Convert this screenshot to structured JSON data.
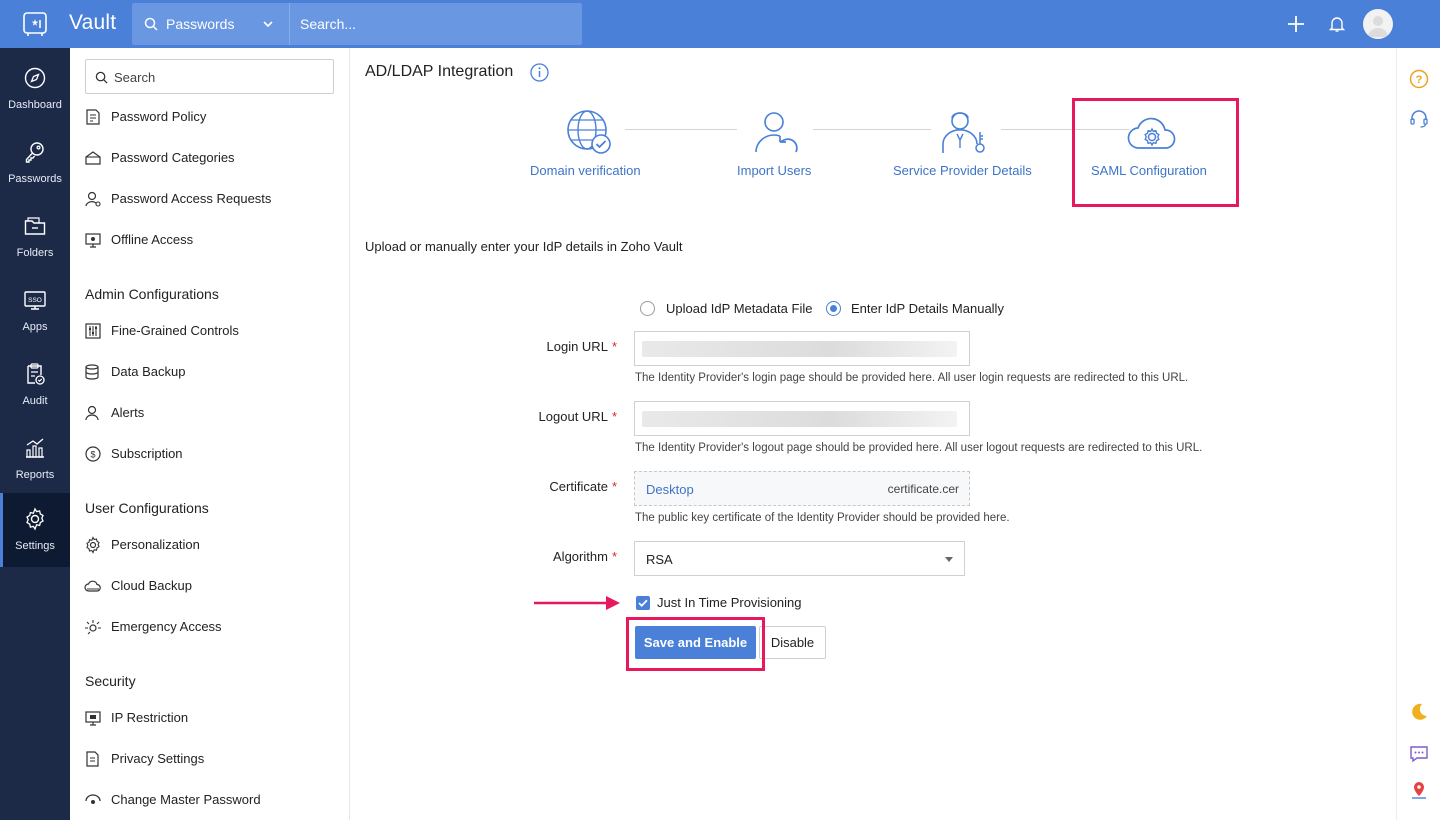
{
  "app": {
    "name": "Vault"
  },
  "topbar": {
    "search_scope": "Passwords",
    "search_placeholder": "Search...",
    "accent": "#4a80d8"
  },
  "rail": {
    "items": [
      {
        "label": "Dashboard",
        "icon": "compass-icon"
      },
      {
        "label": "Passwords",
        "icon": "key-icon"
      },
      {
        "label": "Folders",
        "icon": "folder-icon"
      },
      {
        "label": "Apps",
        "icon": "sso-icon"
      },
      {
        "label": "Audit",
        "icon": "clipboard-icon"
      },
      {
        "label": "Reports",
        "icon": "chart-icon"
      },
      {
        "label": "Settings",
        "icon": "gear-icon",
        "active": true
      }
    ]
  },
  "sidebar": {
    "search_placeholder": "Search",
    "items_top": [
      {
        "label": "Password Policy",
        "icon": "policy-icon"
      },
      {
        "label": "Password Categories",
        "icon": "categories-icon"
      },
      {
        "label": "Password Access Requests",
        "icon": "access-request-icon"
      },
      {
        "label": "Offline Access",
        "icon": "offline-icon"
      }
    ],
    "admin_heading": "Admin Configurations",
    "admin_items": [
      {
        "label": "Fine-Grained Controls",
        "icon": "sliders-icon"
      },
      {
        "label": "Data Backup",
        "icon": "database-icon"
      },
      {
        "label": "Alerts",
        "icon": "alert-user-icon"
      },
      {
        "label": "Subscription",
        "icon": "dollar-icon"
      }
    ],
    "user_heading": "User Configurations",
    "user_items": [
      {
        "label": "Personalization",
        "icon": "gear-icon"
      },
      {
        "label": "Cloud Backup",
        "icon": "cloud-icon"
      },
      {
        "label": "Emergency Access",
        "icon": "emergency-icon"
      }
    ],
    "security_heading": "Security",
    "security_items": [
      {
        "label": "IP Restriction",
        "icon": "monitor-icon"
      },
      {
        "label": "Privacy Settings",
        "icon": "document-icon"
      },
      {
        "label": "Change Master Password",
        "icon": "key-change-icon"
      }
    ]
  },
  "main": {
    "title": "AD/LDAP Integration",
    "steps": [
      {
        "label": "Domain verification",
        "icon": "globe-check-icon"
      },
      {
        "label": "Import Users",
        "icon": "user-import-icon"
      },
      {
        "label": "Service Provider Details",
        "icon": "provider-icon"
      },
      {
        "label": "SAML Configuration",
        "icon": "cloud-gear-icon",
        "highlighted": true
      }
    ],
    "intro": "Upload or manually enter your IdP details in Zoho Vault",
    "radio_options": [
      {
        "label": "Upload IdP Metadata File",
        "selected": false
      },
      {
        "label": "Enter IdP Details Manually",
        "selected": true
      }
    ],
    "fields": {
      "login_url": {
        "label": "Login URL",
        "hint": "The Identity Provider's login page should be provided here. All user login requests are redirected to this URL."
      },
      "logout_url": {
        "label": "Logout URL",
        "hint": "The Identity Provider's logout page should be provided here. All user logout requests are redirected to this URL."
      },
      "certificate": {
        "label": "Certificate",
        "button": "Desktop",
        "file_name": "certificate.cer",
        "hint": "The public key certificate of the Identity Provider should be provided here."
      },
      "algorithm": {
        "label": "Algorithm",
        "value": "RSA"
      }
    },
    "required_mark": "*",
    "jit": {
      "label": "Just In Time Provisioning",
      "checked": true
    },
    "actions": {
      "primary": "Save and Enable",
      "secondary": "Disable"
    },
    "highlight_color": "#e8185c"
  }
}
